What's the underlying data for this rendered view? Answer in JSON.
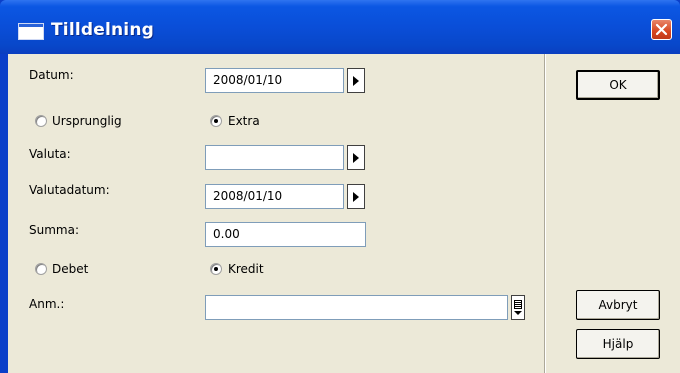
{
  "window": {
    "title": "Tilldelning",
    "close_label": "X"
  },
  "form": {
    "datum_label": "Datum:",
    "datum_value": "2008/01/10",
    "type_options": [
      "Ursprunglig",
      "Extra"
    ],
    "type_selected": "Extra",
    "valuta_label": "Valuta:",
    "valuta_value": "",
    "valutadatum_label": "Valutadatum:",
    "valutadatum_value": "2008/01/10",
    "summa_label": "Summa:",
    "summa_value": "0.00",
    "side_options": [
      "Debet",
      "Kredit"
    ],
    "side_selected": "Kredit",
    "anm_label": "Anm.:",
    "anm_value": ""
  },
  "buttons": {
    "ok": "OK",
    "cancel": "Avbryt",
    "help": "Hjälp"
  },
  "icons": {
    "window_icon": "window-icon",
    "close": "close-icon",
    "date_picker": "right-arrow-icon",
    "currency_picker": "right-arrow-icon",
    "list_picker": "list-dropdown-icon"
  },
  "colors": {
    "titlebar": "#0a4ed8",
    "client": "#ece9d8",
    "close": "#d7461f"
  }
}
